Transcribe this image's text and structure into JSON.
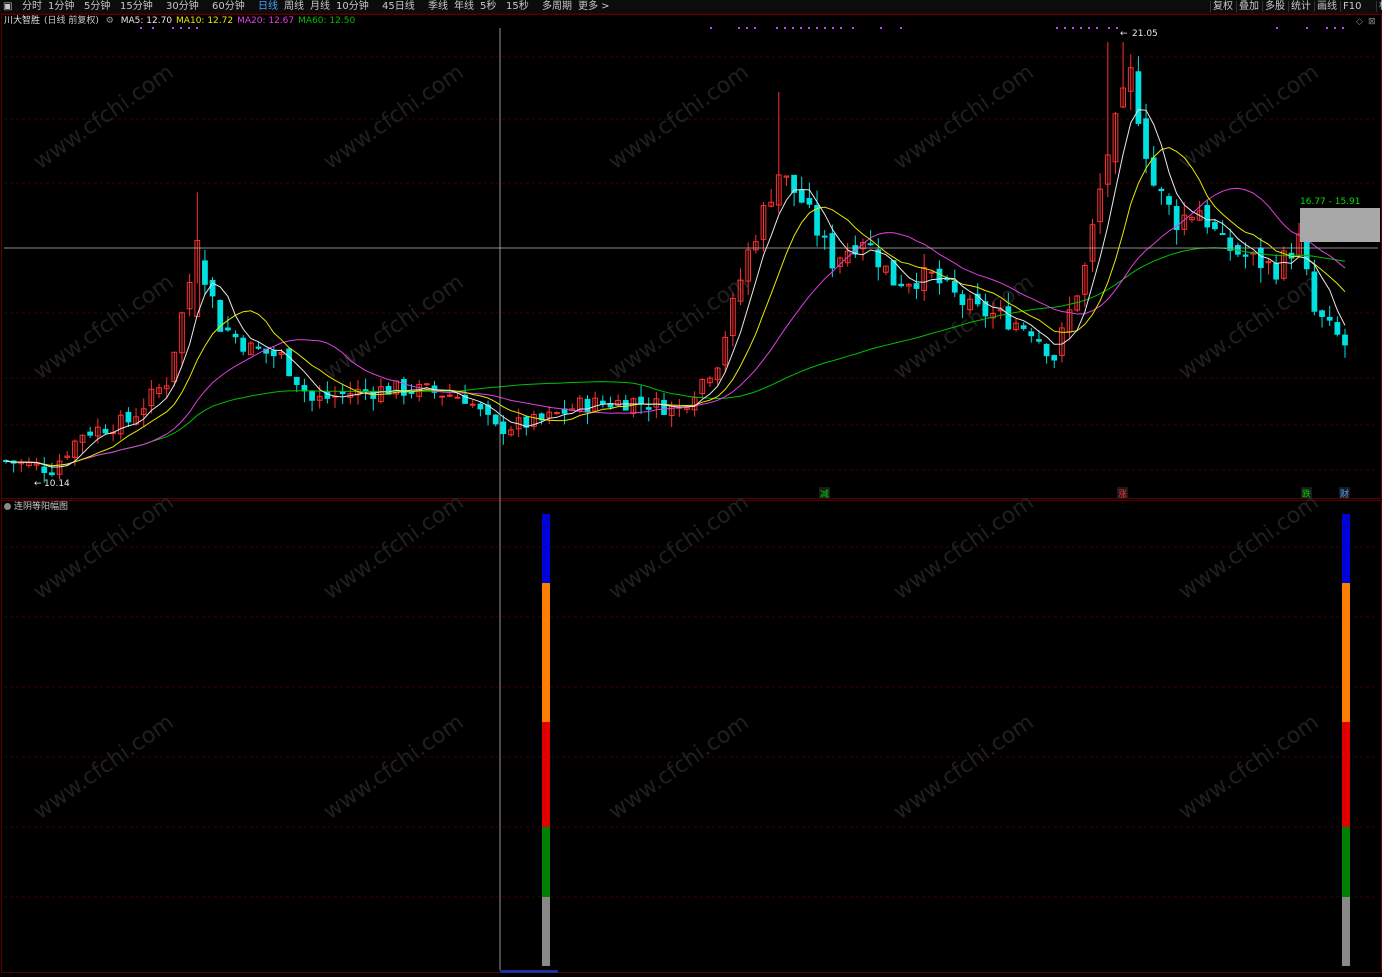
{
  "toolbar": {
    "tabs": [
      "分时",
      "1分钟",
      "5分钟",
      "15分钟",
      "30分钟",
      "60分钟",
      "日线",
      "周线",
      "月线",
      "10分钟",
      "45日线",
      "季线",
      "年线",
      "5秒",
      "15秒",
      "多周期",
      "更多 >"
    ],
    "active_tab": "日线",
    "right_tabs": [
      "复权",
      "叠加",
      "多股",
      "统计",
      "画线",
      "F10",
      "标记"
    ]
  },
  "main_chart": {
    "stock_name": "川大智胜",
    "period_label": "(日线 前复权)",
    "ma_labels": [
      {
        "text": "MA5: 12.70",
        "color": "#e8e8e8"
      },
      {
        "text": "MA10: 12.72",
        "color": "#e8e800"
      },
      {
        "text": "MA20: 12.67",
        "color": "#e040e0"
      },
      {
        "text": "MA60: 12.50",
        "color": "#00c000"
      }
    ],
    "high_label": "21.05",
    "low_label": "10.14",
    "price_box_label": "16.77 - 15.91",
    "event_markers": [
      {
        "text": "减",
        "color": "#00d000"
      },
      {
        "text": "涨",
        "color": "#ff3030"
      },
      {
        "text": "跌",
        "color": "#00d000"
      },
      {
        "text": "财",
        "color": "#4aa3ff"
      }
    ]
  },
  "indicator": {
    "name": "连阴等阳幅图",
    "segment_colors": [
      "#0000d8",
      "#ff7f00",
      "#e00000",
      "#008000",
      "#888888"
    ]
  },
  "watermark_text": "www.cfchi.com",
  "colors": {
    "up": "#ff3030",
    "down": "#00e0e0",
    "ma5": "#e8e8e8",
    "ma10": "#e8e800",
    "ma20": "#e040e0",
    "ma60": "#00c000"
  }
}
